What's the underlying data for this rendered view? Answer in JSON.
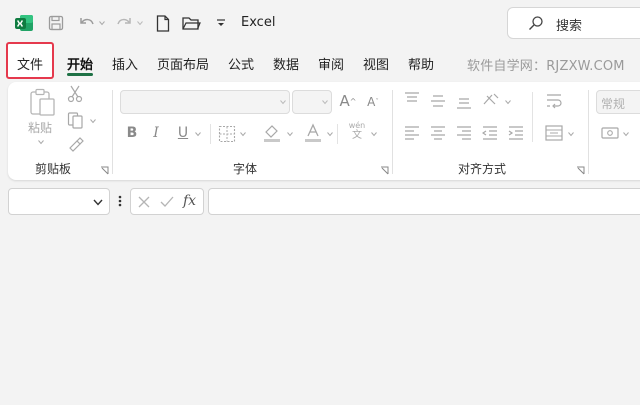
{
  "app": {
    "title": "Excel"
  },
  "search": {
    "label": "搜索"
  },
  "tabs": [
    "文件",
    "开始",
    "插入",
    "页面布局",
    "公式",
    "数据",
    "审阅",
    "视图",
    "帮助"
  ],
  "watermark": "软件自学网：RJZXW.COM",
  "ribbon": {
    "clipboard": {
      "paste_label": "粘贴",
      "group_label": "剪贴板"
    },
    "font": {
      "group_label": "字体",
      "phonetic_top": "wén",
      "phonetic_bottom": "文"
    },
    "alignment": {
      "group_label": "对齐方式"
    },
    "number": {
      "format_value": "常规"
    }
  },
  "formula_bar": {
    "fx_label": "fx"
  },
  "colors": {
    "accent_green": "#1e7145",
    "highlight_red": "#e5394d"
  }
}
